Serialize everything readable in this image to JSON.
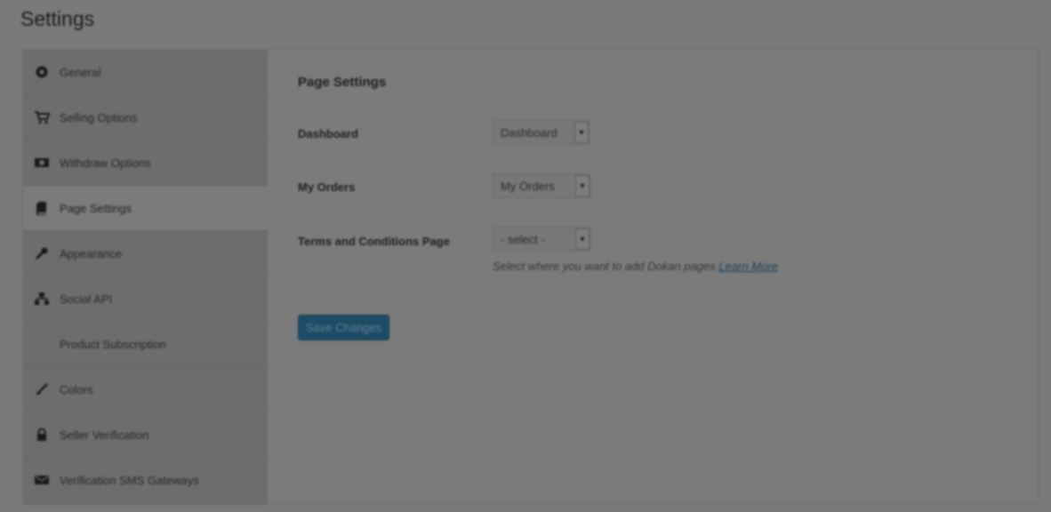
{
  "page_title": "Settings",
  "sidebar": {
    "items": [
      {
        "label": "General",
        "icon": "gear-icon"
      },
      {
        "label": "Selling Options",
        "icon": "cart-icon"
      },
      {
        "label": "Withdraw Options",
        "icon": "money-icon"
      },
      {
        "label": "Page Settings",
        "icon": "page-icon"
      },
      {
        "label": "Appearance",
        "icon": "wrench-icon"
      },
      {
        "label": "Social API",
        "icon": "sitemap-icon"
      },
      {
        "label": "Product Subscription",
        "icon": ""
      },
      {
        "label": "Colors",
        "icon": "brush-icon"
      },
      {
        "label": "Seller Verification",
        "icon": "lock-icon"
      },
      {
        "label": "Verification SMS Gateways",
        "icon": "envelope-icon"
      }
    ],
    "active_index": 3
  },
  "main": {
    "section_title": "Page Settings",
    "fields": [
      {
        "label": "Dashboard",
        "value": "Dashboard"
      },
      {
        "label": "My Orders",
        "value": "My Orders"
      },
      {
        "label": "Terms and Conditions Page",
        "value": "- select -"
      }
    ],
    "help_text": "Select where you want to add Dokan pages",
    "help_link": "Learn More",
    "save_label": "Save Changes"
  },
  "colors": {
    "overlay_bg": "#7a7a7a",
    "button_bg": "#1e4c67",
    "link": "#183e55"
  }
}
